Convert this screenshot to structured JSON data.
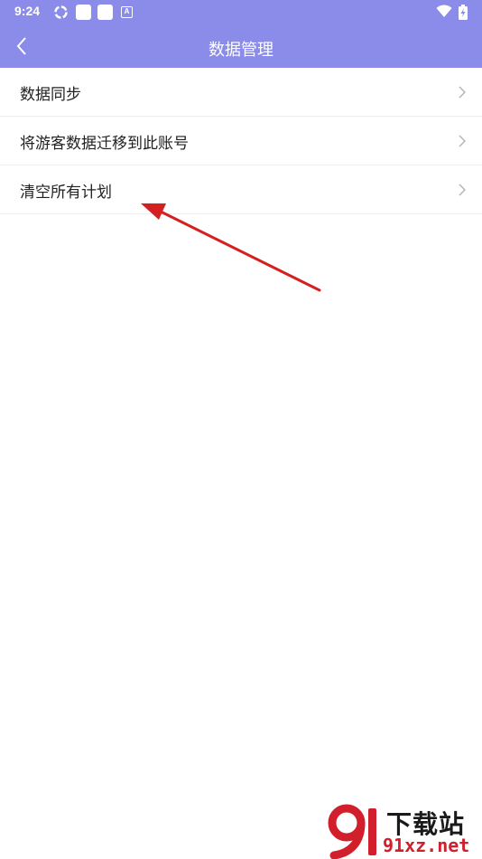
{
  "status_bar": {
    "time": "9:24",
    "icons": [
      "sync-icon",
      "notification-square-icon",
      "notification-square-icon",
      "a-badge-icon",
      "wifi-icon",
      "battery-charging-icon"
    ],
    "a_icon_text": "A"
  },
  "header": {
    "title": "数据管理",
    "back_icon": "chevron-left-icon",
    "background_color": "#8b8bea"
  },
  "list": {
    "items": [
      {
        "label": "数据同步",
        "icon": "chevron-right-icon"
      },
      {
        "label": "将游客数据迁移到此账号",
        "icon": "chevron-right-icon"
      },
      {
        "label": "清空所有计划",
        "icon": "chevron-right-icon"
      }
    ]
  },
  "annotation": {
    "color": "#d42020",
    "points_to": "清空所有计划"
  },
  "watermark": {
    "title": "下载站",
    "domain": "91xz.net",
    "accent_color": "#d11f2b"
  }
}
